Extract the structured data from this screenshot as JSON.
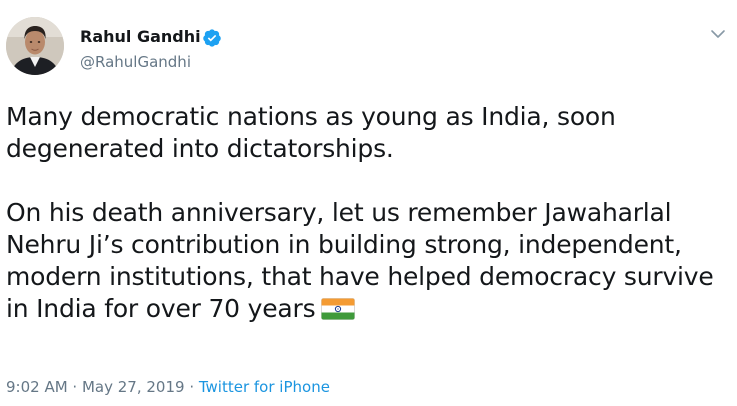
{
  "author": {
    "name": "Rahul Gandhi",
    "handle": "@RahulGandhi",
    "verified": true
  },
  "tweet": {
    "line1": "Many democratic nations as young as India, soon",
    "line2": "degenerated into dictatorships.",
    "line3": "On his death anniversary, let us remember Jawaharlal",
    "line4": "Nehru Ji’s contribution in building strong, independent,",
    "line5": "modern institutions, that have helped democracy survive",
    "line6": "in India for over 70 years",
    "emoji": "flag-india-icon"
  },
  "meta": {
    "time": "9:02 AM",
    "separator1": " · ",
    "date": "May 27, 2019",
    "separator2": " · ",
    "source": "Twitter for iPhone"
  },
  "colors": {
    "text": "#14171a",
    "secondary": "#657786",
    "link": "#1b95e0",
    "verified": "#1da1f2"
  }
}
